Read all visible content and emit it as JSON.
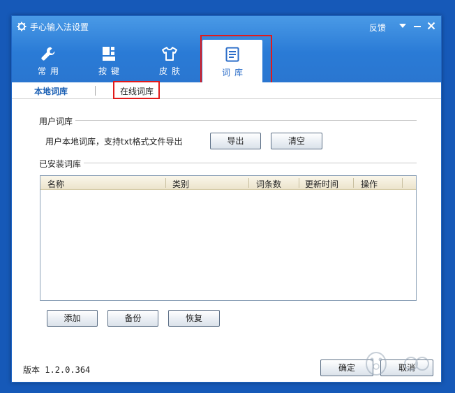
{
  "window": {
    "title": "手心输入法设置",
    "feedback": "反馈"
  },
  "tabs": [
    {
      "label": "常用",
      "icon": "wrench-icon"
    },
    {
      "label": "按键",
      "icon": "keyboard-icon"
    },
    {
      "label": "皮肤",
      "icon": "tshirt-icon"
    },
    {
      "label": "词库",
      "icon": "document-icon",
      "active": true
    }
  ],
  "subtabs": {
    "local": "本地词库",
    "online": "在线词库"
  },
  "user_lexicon": {
    "section_title": "用户词库",
    "description": "用户本地词库，支持txt格式文件导出",
    "export_label": "导出",
    "clear_label": "清空"
  },
  "installed_lexicon": {
    "section_title": "已安装词库",
    "columns": [
      "名称",
      "类别",
      "词条数",
      "更新时间",
      "操作"
    ],
    "rows": []
  },
  "actions": {
    "add_label": "添加",
    "backup_label": "备份",
    "restore_label": "恢复"
  },
  "footer": {
    "version_label": "版本",
    "version_value": "1.2.0.364",
    "ok_label": "确定",
    "cancel_label": "取消"
  },
  "colors": {
    "header_blue": "#2a7bd6",
    "highlight_red": "#e11a1a",
    "active_tab_text": "#2a6cc8"
  }
}
